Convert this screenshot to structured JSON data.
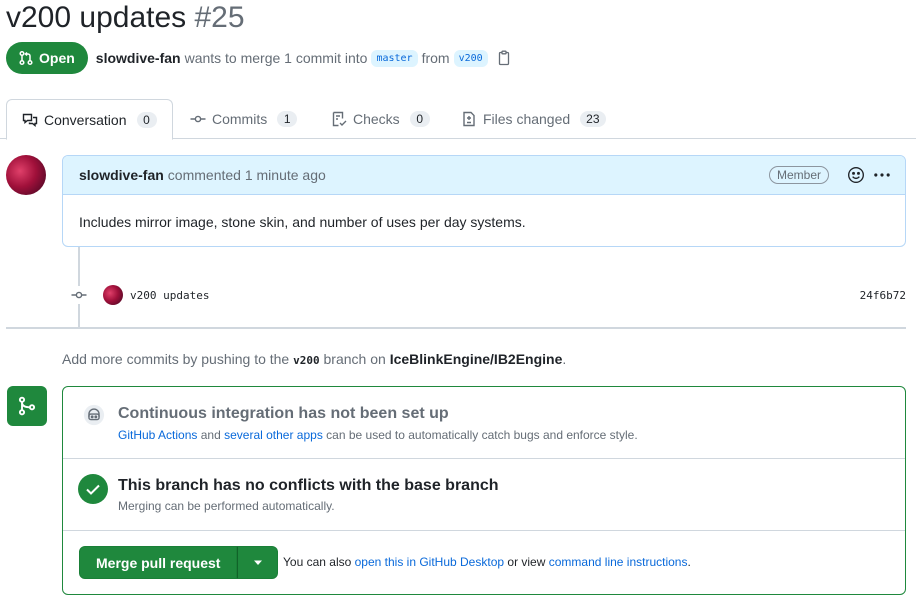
{
  "pr": {
    "title": "v200 updates",
    "number": "#25",
    "state": "Open",
    "author": "slowdive-fan",
    "merge_text_1": "wants to merge 1 commit into",
    "base_branch": "master",
    "merge_text_2": "from",
    "head_branch": "v200"
  },
  "tabs": [
    {
      "label": "Conversation",
      "count": "0"
    },
    {
      "label": "Commits",
      "count": "1"
    },
    {
      "label": "Checks",
      "count": "0"
    },
    {
      "label": "Files changed",
      "count": "23"
    }
  ],
  "comment": {
    "author": "slowdive-fan",
    "action": "commented 1 minute ago",
    "role": "Member",
    "body": "Includes mirror image, stone skin, and number of uses per day systems."
  },
  "commit": {
    "message": "v200 updates",
    "sha": "24f6b72"
  },
  "hint": {
    "prefix": "Add more commits by pushing to the",
    "branch": "v200",
    "middle": "branch on",
    "repo": "IceBlinkEngine/IB2Engine",
    "suffix": "."
  },
  "ci": {
    "title": "Continuous integration has not been set up",
    "link1": "GitHub Actions",
    "text1": "and",
    "link2": "several other apps",
    "text2": "can be used to automatically catch bugs and enforce style."
  },
  "conflicts": {
    "title": "This branch has no conflicts with the base branch",
    "sub": "Merging can be performed automatically."
  },
  "merge": {
    "button": "Merge pull request",
    "also_prefix": "You can also",
    "desktop_link": "open this in GitHub Desktop",
    "also_middle": "or view",
    "cli_link": "command line instructions",
    "also_suffix": "."
  },
  "colors": {
    "success": "#1f883d",
    "link": "#0969da",
    "muted": "#656d76",
    "header_blue": "#ddf4ff"
  }
}
